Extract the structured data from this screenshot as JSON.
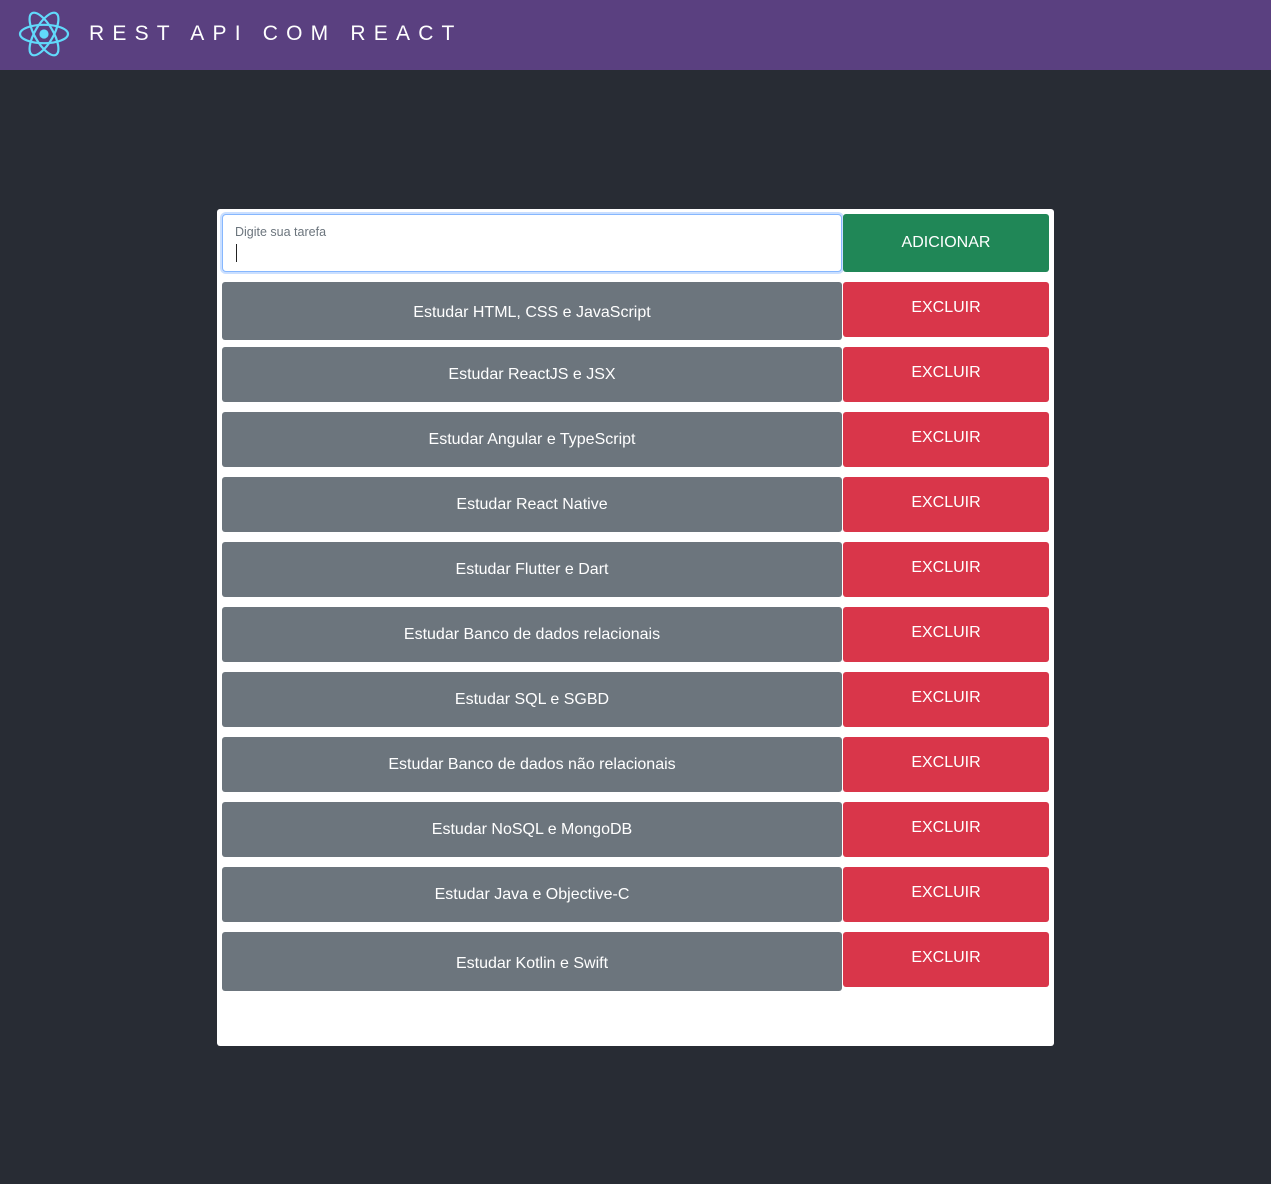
{
  "header": {
    "logo_icon": "react-atom-logo-icon",
    "title": "REST API COM REACT",
    "colors": {
      "bar": "#5a4080",
      "logo": "#61dafb"
    }
  },
  "form": {
    "input_label": "Digite sua tarefa",
    "input_value": "",
    "add_label": "ADICIONAR",
    "add_color": "#208757"
  },
  "tasks": [
    {
      "title": "Estudar HTML, CSS e JavaScript",
      "delete_label": "EXCLUIR"
    },
    {
      "title": "Estudar ReactJS e JSX",
      "delete_label": "EXCLUIR"
    },
    {
      "title": "Estudar Angular e TypeScript",
      "delete_label": "EXCLUIR"
    },
    {
      "title": "Estudar React Native",
      "delete_label": "EXCLUIR"
    },
    {
      "title": "Estudar Flutter e Dart",
      "delete_label": "EXCLUIR"
    },
    {
      "title": "Estudar Banco de dados relacionais",
      "delete_label": "EXCLUIR"
    },
    {
      "title": "Estudar SQL e SGBD",
      "delete_label": "EXCLUIR"
    },
    {
      "title": "Estudar Banco de dados não relacionais",
      "delete_label": "EXCLUIR"
    },
    {
      "title": "Estudar NoSQL e MongoDB",
      "delete_label": "EXCLUIR"
    },
    {
      "title": "Estudar Java e Objective-C",
      "delete_label": "EXCLUIR"
    },
    {
      "title": "Estudar Kotlin e Swift",
      "delete_label": "EXCLUIR"
    }
  ],
  "colors": {
    "page_background": "#282c34",
    "task_background": "#6c757d",
    "delete_button": "#d9364a"
  }
}
